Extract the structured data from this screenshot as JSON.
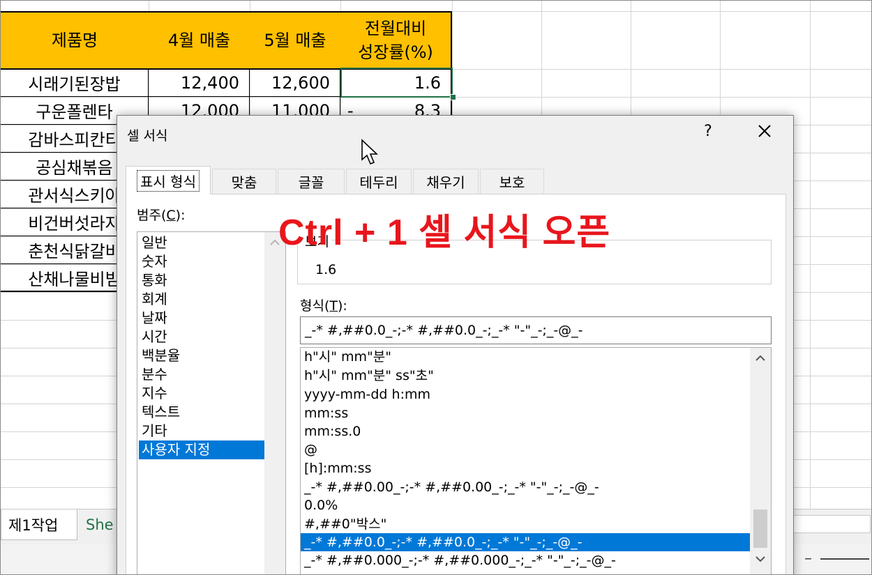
{
  "sheet": {
    "headers": [
      "제품명",
      "4월 매출",
      "5월 매출",
      "전월대비\n성장률(%)"
    ],
    "header_lines": {
      "growth_line1": "전월대비",
      "growth_line2": "성장률(%)"
    },
    "rows": [
      {
        "name": "시래기된장밥",
        "apr": "12,400",
        "may": "12,600",
        "growth": "1.6",
        "neg": ""
      },
      {
        "name": "구운폴렌타",
        "apr": "12,000",
        "may": "11,000",
        "growth": "8.3",
        "neg": "-"
      },
      {
        "name": "감바스피칸티",
        "apr": "",
        "may": "",
        "growth": "",
        "neg": ""
      },
      {
        "name": "공심채볶음",
        "apr": "",
        "may": "",
        "growth": "",
        "neg": ""
      },
      {
        "name": "관서식스키야",
        "apr": "",
        "may": "",
        "growth": "",
        "neg": ""
      },
      {
        "name": "비건버섯라자",
        "apr": "",
        "may": "",
        "growth": "",
        "neg": ""
      },
      {
        "name": "춘천식닭갈비",
        "apr": "",
        "may": "",
        "growth": "",
        "neg": ""
      },
      {
        "name": "산채나물비빔",
        "apr": "",
        "may": "",
        "growth": "",
        "neg": ""
      }
    ],
    "header_color": "#ffc000",
    "tabs": [
      "제1작업",
      "She"
    ]
  },
  "dialog": {
    "title": "셀 서식",
    "help": "?",
    "tabs": [
      "표시 형식",
      "맞춤",
      "글꼴",
      "테두리",
      "채우기",
      "보호"
    ],
    "active_tab": "표시 형식",
    "category_label": "범주(",
    "category_label_key": "C",
    "category_label_end": "):",
    "categories": [
      "일반",
      "숫자",
      "통화",
      "회계",
      "날짜",
      "시간",
      "백분율",
      "분수",
      "지수",
      "텍스트",
      "기타",
      "사용자 지정"
    ],
    "selected_category": "사용자 지정",
    "sample_label": "보기",
    "sample_value": "1.6",
    "format_label": "형식(",
    "format_label_key": "T",
    "format_label_end": "):",
    "format_value": "_-* #,##0.0_-;-* #,##0.0_-;_-* \"-\"_-;_-@_-",
    "formats": [
      "h\"시\" mm\"분\"",
      "h\"시\" mm\"분\" ss\"초\"",
      "yyyy-mm-dd h:mm",
      "mm:ss",
      "mm:ss.0",
      "@",
      "[h]:mm:ss",
      "_-* #,##0.00_-;-* #,##0.00_-;_-* \"-\"_-;_-@_-",
      "0.0%",
      "#,##0\"박스\"",
      "_-* #,##0.0_-;-* #,##0.0_-;_-* \"-\"_-;_-@_-",
      "_-* #,##0.000_-;-* #,##0.000_-;_-* \"-\"_-;_-@_-"
    ],
    "selected_format_index": 10,
    "accent_color": "#0078d7"
  },
  "overlay_text": "Ctrl + 1 셀 서식 오픈",
  "overlay_color": "#e8161c"
}
